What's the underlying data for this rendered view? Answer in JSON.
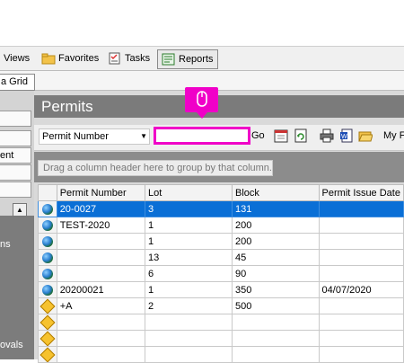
{
  "toolbar": {
    "views_label": "Views",
    "favorites_label": "Favorites",
    "tasks_label": "Tasks",
    "reports_label": "Reports"
  },
  "subtab": {
    "label": "a Grid"
  },
  "sidebar": {
    "items": [
      "",
      "",
      "ent",
      "",
      ""
    ],
    "dark_texts": [
      "ns",
      "ovals"
    ]
  },
  "permits": {
    "title": "Permits",
    "search_field": "Permit Number",
    "search_value": "",
    "go_label": "Go",
    "my_filter_label": "My F",
    "group_hint": "Drag a column header here to group by that column."
  },
  "grid": {
    "columns": [
      "Permit Number",
      "Lot",
      "Block",
      "Permit Issue Date"
    ],
    "rows": [
      {
        "icon": "globe-icon",
        "cells": [
          "20-0027",
          "3",
          "131",
          ""
        ],
        "selected": true
      },
      {
        "icon": "globe-icon",
        "cells": [
          "TEST-2020",
          "1",
          "200",
          ""
        ]
      },
      {
        "icon": "globe-icon",
        "cells": [
          "",
          "1",
          "200",
          ""
        ]
      },
      {
        "icon": "globe-icon",
        "cells": [
          "",
          "13",
          "45",
          ""
        ]
      },
      {
        "icon": "globe-icon",
        "cells": [
          "",
          "6",
          "90",
          ""
        ]
      },
      {
        "icon": "globe-icon",
        "cells": [
          "20200021",
          "1",
          "350",
          "04/07/2020"
        ]
      },
      {
        "icon": "diamond-icon",
        "cells": [
          "+A",
          "2",
          "500",
          ""
        ]
      },
      {
        "icon": "diamond-icon",
        "cells": [
          "",
          "",
          "",
          ""
        ]
      },
      {
        "icon": "diamond-icon",
        "cells": [
          "",
          "",
          "",
          ""
        ]
      },
      {
        "icon": "diamond-icon",
        "cells": [
          "",
          "",
          "",
          ""
        ]
      }
    ]
  },
  "colors": {
    "highlight": "#f000c8",
    "selection": "#0a6fd6",
    "header_gray": "#7b7b7b"
  }
}
